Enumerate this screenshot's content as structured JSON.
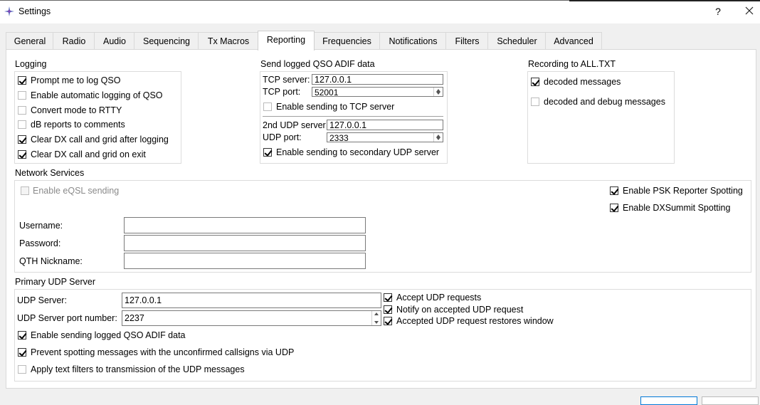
{
  "window": {
    "title": "Settings",
    "help": "?",
    "close_icon": "close-icon"
  },
  "tabs": [
    {
      "label": "General"
    },
    {
      "label": "Radio"
    },
    {
      "label": "Audio"
    },
    {
      "label": "Sequencing"
    },
    {
      "label": "Tx Macros"
    },
    {
      "label": "Reporting",
      "active": true
    },
    {
      "label": "Frequencies"
    },
    {
      "label": "Notifications"
    },
    {
      "label": "Filters"
    },
    {
      "label": "Scheduler"
    },
    {
      "label": "Advanced"
    }
  ],
  "logging": {
    "title": "Logging",
    "items": [
      {
        "label": "Prompt me to log QSO",
        "checked": true
      },
      {
        "label": "Enable automatic logging of QSO",
        "checked": false
      },
      {
        "label": "Convert mode to RTTY",
        "checked": false
      },
      {
        "label": "dB reports to comments",
        "checked": false
      },
      {
        "label": "Clear DX call and grid after logging",
        "checked": true
      },
      {
        "label": "Clear DX call and grid on exit",
        "checked": true
      }
    ]
  },
  "adif": {
    "title": "Send logged QSO ADIF data",
    "tcp_server_label": "TCP server:",
    "tcp_server_value": "127.0.0.1",
    "tcp_port_label": "TCP port:",
    "tcp_port_value": "52001",
    "tcp_enable_label": "Enable sending to TCP server",
    "tcp_enable_checked": false,
    "udp2_server_label": "2nd UDP server",
    "udp2_server_value": "127.0.0.1",
    "udp_port_label": "UDP port:",
    "udp_port_value": "2333",
    "udp2_enable_label": "Enable sending to secondary UDP server",
    "udp2_enable_checked": true
  },
  "recording": {
    "title": "Recording to ALL.TXT",
    "items": [
      {
        "label": "decoded messages",
        "checked": true
      },
      {
        "label": "decoded and debug messages",
        "checked": false
      }
    ]
  },
  "network": {
    "title": "Network Services",
    "eqsl_label": "Enable eQSL sending",
    "psk_label": "Enable PSK Reporter Spotting",
    "dxsummit_label": "Enable DXSummit Spotting",
    "username_label": "Username:",
    "password_label": "Password:",
    "qth_label": "QTH Nickname:",
    "username_value": "",
    "password_value": "",
    "qth_value": ""
  },
  "primary_udp": {
    "title": "Primary UDP Server",
    "server_label": "UDP Server:",
    "server_value": "127.0.0.1",
    "port_label": "UDP Server port number:",
    "port_value": "2237",
    "accept_label": "Accept UDP requests",
    "notify_label": "Notify on accepted UDP request",
    "restore_label": "Accepted UDP request restores window",
    "adif_label": "Enable sending logged QSO ADIF data",
    "prevent_label": "Prevent spotting messages with the unconfirmed callsigns via UDP",
    "filters_label": "Apply text filters to transmission of the UDP messages"
  }
}
